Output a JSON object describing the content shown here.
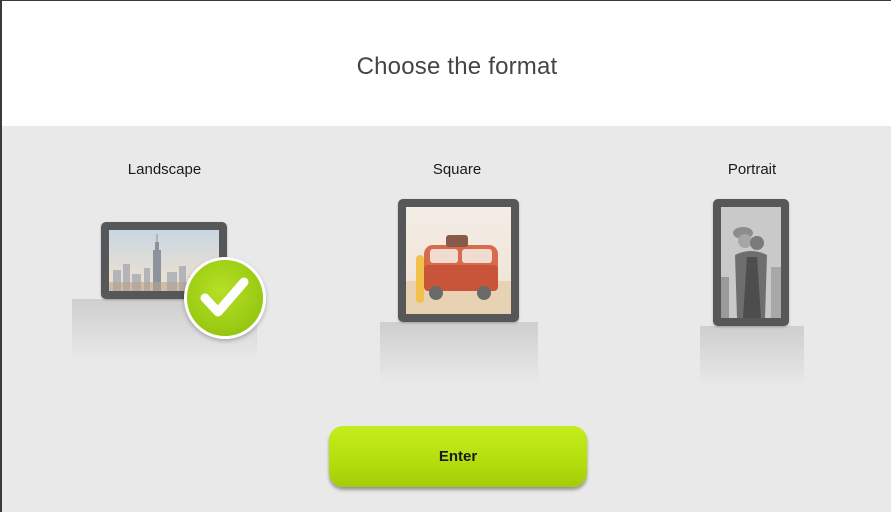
{
  "header": {
    "title": "Choose the format"
  },
  "formats": [
    {
      "label": "Landscape",
      "selected": true,
      "icon": "landscape-photo"
    },
    {
      "label": "Square",
      "selected": false,
      "icon": "square-photo"
    },
    {
      "label": "Portrait",
      "selected": false,
      "icon": "portrait-photo"
    }
  ],
  "selection_badge": {
    "icon": "checkmark-icon"
  },
  "actions": {
    "enter_label": "Enter"
  },
  "colors": {
    "accent": "#b4e00e",
    "content_background": "#e9e9e9",
    "frame": "#555759"
  }
}
